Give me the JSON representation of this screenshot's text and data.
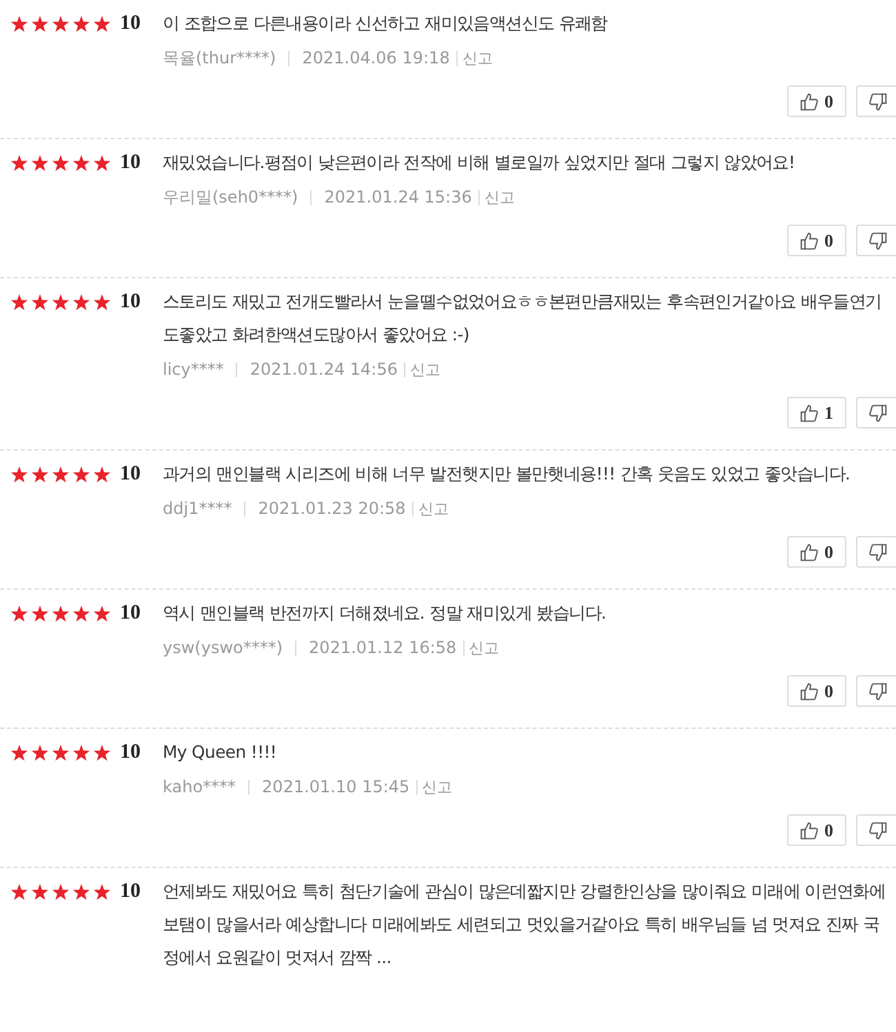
{
  "reviews": [
    {
      "stars": 5,
      "score": "10",
      "text": "이 조합으로 다른내용이라 신선하고 재미있음액션신도 유쾌함",
      "author": "목율(thur****)",
      "date": "2021.04.06 19:18",
      "report": "신고",
      "likes": "0"
    },
    {
      "stars": 5,
      "score": "10",
      "text": "재밌었습니다.평점이 낮은편이라 전작에 비해 별로일까 싶었지만 절대 그렇지 않았어요!",
      "author": "우리밀(seh0****)",
      "date": "2021.01.24 15:36",
      "report": "신고",
      "likes": "0"
    },
    {
      "stars": 5,
      "score": "10",
      "text": "스토리도 재밌고 전개도빨라서 눈을뗼수없었어요ㅎㅎ본편만큼재밌는 후속편인거같아요 배우들연기도좋았고 화려한액션도많아서 좋았어요 :-)",
      "author": "licy****",
      "date": "2021.01.24 14:56",
      "report": "신고",
      "likes": "1"
    },
    {
      "stars": 5,
      "score": "10",
      "text": "과거의 맨인블랙 시리즈에 비해 너무 발전햇지만 볼만햇네용!!! 간혹 웃음도 있었고 좋앗습니다.",
      "author": "ddj1****",
      "date": "2021.01.23 20:58",
      "report": "신고",
      "likes": "0"
    },
    {
      "stars": 5,
      "score": "10",
      "text": "역시 맨인블랙 반전까지 더해졌네요. 정말 재미있게 봤습니다.",
      "author": "ysw(yswo****)",
      "date": "2021.01.12 16:58",
      "report": "신고",
      "likes": "0"
    },
    {
      "stars": 5,
      "score": "10",
      "text": "My Queen !!!!",
      "author": "kaho****",
      "date": "2021.01.10 15:45",
      "report": "신고",
      "likes": "0"
    },
    {
      "stars": 5,
      "score": "10",
      "text": "언제봐도 재밌어요 특히 첨단기술에 관심이 많은데짧지만 강렬한인상을 많이줘요 미래에 이런연화에 보탬이 많을서라 예상합니다 미래에봐도 세련되고 멋있을거같아요 특히 배우님들 넘 멋져요 진짜 국정에서 요원같이 멋져서 깜짝 ..."
    }
  ]
}
